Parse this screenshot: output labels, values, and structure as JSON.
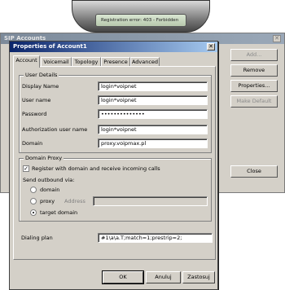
{
  "phone": {
    "status": "Registration error: 403 - Forbidden"
  },
  "sip_window": {
    "title": "SIP Accounts",
    "buttons": {
      "add": "Add...",
      "remove": "Remove",
      "properties": "Properties...",
      "make_default": "Make Default",
      "close": "Close"
    }
  },
  "dialog": {
    "title": "Properties of Account1",
    "tabs": [
      "Account",
      "Voicemail",
      "Topology",
      "Presence",
      "Advanced"
    ],
    "user_details": {
      "legend": "User Details",
      "display_name": {
        "label": "Display Name",
        "value": "login*voipnet"
      },
      "user_name": {
        "label": "User name",
        "value": "login*voipnet"
      },
      "password": {
        "label": "Password",
        "value": "••••••••••••••"
      },
      "auth_user": {
        "label": "Authorization user name",
        "value": "login*voipnet"
      },
      "domain": {
        "label": "Domain",
        "value": "proxy.voipmax.pl"
      }
    },
    "domain_proxy": {
      "legend": "Domain Proxy",
      "register_checkbox": "Register with domain and receive incoming calls",
      "register_checked": true,
      "send_outbound": "Send outbound via:",
      "options": [
        "domain",
        "proxy",
        "target domain"
      ],
      "selected": "target domain",
      "address_label": "Address",
      "address_value": ""
    },
    "dialing_plan": {
      "label": "Dialing plan",
      "value": "#1\\a\\a.T;match=1;prestrip=2;"
    },
    "buttons": {
      "ok": "OK",
      "cancel": "Anuluj",
      "apply": "Zastosuj"
    }
  }
}
